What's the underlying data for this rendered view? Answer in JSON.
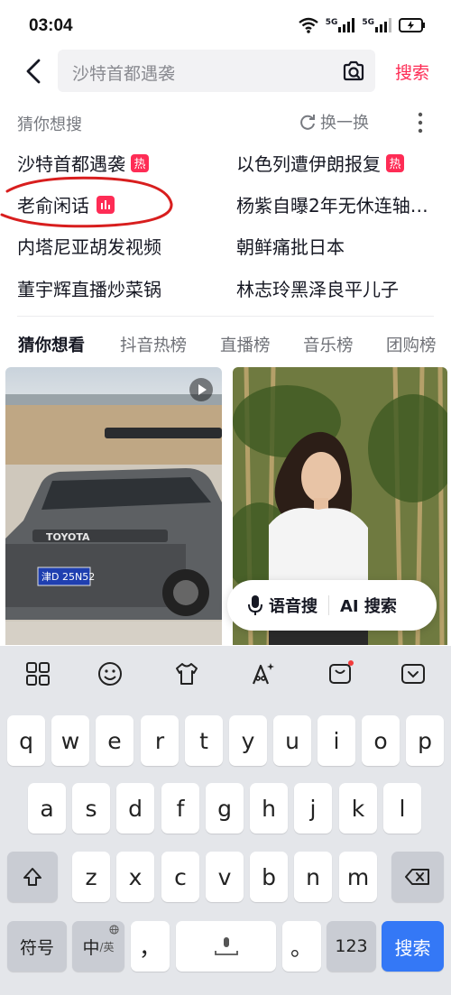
{
  "status": {
    "time": "03:04",
    "net1": "5G",
    "net2": "5G"
  },
  "search": {
    "text": "沙特首都遇袭",
    "submit_label": "搜索"
  },
  "guess": {
    "title": "猜你想搜",
    "refresh_label": "换一换",
    "items": [
      {
        "text": "沙特首都遇袭",
        "badge": "热"
      },
      {
        "text": "以色列遭伊朗报复",
        "badge": "热"
      },
      {
        "text": "老俞闲话",
        "badge": "live"
      },
      {
        "text": "杨紫自曝2年无休连轴…",
        "badge": ""
      },
      {
        "text": "内塔尼亚胡发视频",
        "badge": ""
      },
      {
        "text": "朝鲜痛批日本",
        "badge": ""
      },
      {
        "text": "董宇辉直播炒菜锅",
        "badge": ""
      },
      {
        "text": "林志玲黑泽良平儿子",
        "badge": ""
      }
    ]
  },
  "tabs": [
    "猜你想看",
    "抖音热榜",
    "直播榜",
    "音乐榜",
    "团购榜"
  ],
  "feed": {
    "left_card": {
      "brand": "TOYOTA",
      "plate": "津D 25N52"
    },
    "voice_search_label": "语音搜",
    "ai_search_label": "AI 搜索"
  },
  "keyboard": {
    "row1": [
      "q",
      "w",
      "e",
      "r",
      "t",
      "y",
      "u",
      "i",
      "o",
      "p"
    ],
    "row2": [
      "a",
      "s",
      "d",
      "f",
      "g",
      "h",
      "j",
      "k",
      "l"
    ],
    "row3": [
      "z",
      "x",
      "c",
      "v",
      "b",
      "n",
      "m"
    ],
    "symbols_label": "符号",
    "lang_label": "中",
    "lang_sub": "/英",
    "comma": "，",
    "period": "。",
    "numbers_label": "123",
    "enter_label": "搜索"
  },
  "colors": {
    "accent": "#fe2c55",
    "keyboard_enter": "#3478f6",
    "annotation": "#d81e1e"
  }
}
